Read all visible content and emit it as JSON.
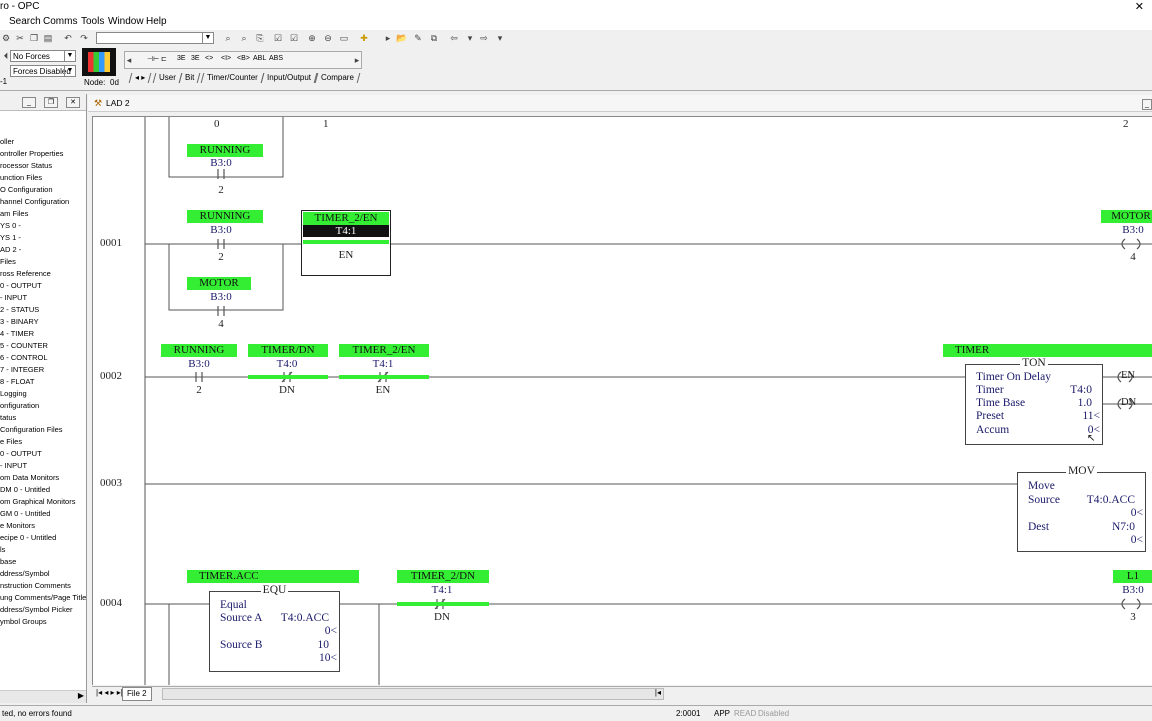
{
  "window": {
    "title": "ro - OPC",
    "close_glyph": "✕"
  },
  "menu": [
    "Search",
    "Comms",
    "Tools",
    "Window",
    "Help"
  ],
  "toolbar": {
    "forces_combo": "No Forces",
    "forces_state": "Forces Disabled",
    "node_label": "Node:",
    "node_value": "0d",
    "left_edge_label": "-1",
    "tabs": [
      "User",
      "Bit",
      "Timer/Counter",
      "Input/Output",
      "Compare"
    ],
    "instruction_glyphs": [
      "⊣⊢",
      "⊏",
      "3E",
      "3E",
      "<>",
      "<I>",
      "<B>",
      "ABL",
      "ABS"
    ]
  },
  "project_tree": [
    "oller",
    "ontroller Properties",
    "rocessor Status",
    "unction Files",
    "O Configuration",
    "hannel Configuration",
    "am Files",
    "YS 0 -",
    "YS 1 -",
    "AD 2 -",
    "Files",
    "ross Reference",
    "0 - OUTPUT",
    "- INPUT",
    "2 - STATUS",
    "3 - BINARY",
    "4 - TIMER",
    "5 - COUNTER",
    "6 - CONTROL",
    "7 - INTEGER",
    "8 - FLOAT",
    "Logging",
    "onfiguration",
    "tatus",
    "Configuration Files",
    "e Files",
    "0 - OUTPUT",
    "- INPUT",
    "om Data Monitors",
    "DM 0 - Untitled",
    "om Graphical Monitors",
    "GM 0 - Untitled",
    "e Monitors",
    "ecipe 0 - Untitled",
    "ls",
    "base",
    "ddress/Symbol",
    "nstruction Comments",
    "ung Comments/Page Title",
    "ddress/Symbol Picker",
    "ymbol Groups"
  ],
  "ladder": {
    "window_title": "LAD 2",
    "file_tab": "File 2",
    "columns": [
      "0",
      "1",
      "2"
    ],
    "rungs": [
      "0001",
      "0002",
      "0003",
      "0004"
    ],
    "rung0_tail": {
      "tag": "RUNNING",
      "addr": "B3:0",
      "bit": "2"
    },
    "rung1": {
      "xic_running": {
        "tag": "RUNNING",
        "addr": "B3:0",
        "bit": "2"
      },
      "xio_timer": {
        "tag": "TIMER_2/EN",
        "addr": "T4:1",
        "bit": "EN"
      },
      "xic_motor": {
        "tag": "MOTOR",
        "addr": "B3:0",
        "bit": "4"
      },
      "ote_motor": {
        "tag": "MOTOR",
        "addr": "B3:0",
        "bit": "4"
      }
    },
    "rung2": {
      "xic_running": {
        "tag": "RUNNING",
        "addr": "B3:0",
        "bit": "2"
      },
      "xio_timer_dn": {
        "tag": "TIMER/DN",
        "addr": "T4:0",
        "bit": "DN"
      },
      "xio_timer2_en": {
        "tag": "TIMER_2/EN",
        "addr": "T4:1",
        "bit": "EN"
      },
      "ton": {
        "tag": "TIMER",
        "title": "TON",
        "desc": "Timer On Delay",
        "timer_label": "Timer",
        "timer_value": "T4:0",
        "timebase_label": "Time Base",
        "timebase_value": "1.0",
        "preset_label": "Preset",
        "preset_value": "11<",
        "accum_label": "Accum",
        "accum_value": "0<",
        "en": "EN",
        "dn": "DN"
      }
    },
    "rung3": {
      "mov": {
        "title": "MOV",
        "desc": "Move",
        "source_label": "Source",
        "source_value": "T4:0.ACC",
        "source_live": "0<",
        "dest_label": "Dest",
        "dest_value": "N7:0",
        "dest_live": "0<"
      }
    },
    "rung4": {
      "equ": {
        "tag": "TIMER.ACC",
        "title": "EQU",
        "desc": "Equal",
        "srca_label": "Source A",
        "srca_value": "T4:0.ACC",
        "srca_live": "0<",
        "srcb_label": "Source B",
        "srcb_value": "10",
        "srcb_live": "10<"
      },
      "xio_timer2_dn": {
        "tag": "TIMER_2/DN",
        "addr": "T4:1",
        "bit": "DN"
      },
      "otl": {
        "tag": "L1",
        "addr": "B3:0",
        "bit": "3"
      }
    }
  },
  "status": {
    "message": "ted, no errors found",
    "rung_pos": "2:0001",
    "mode": "APP",
    "read": "READ",
    "disabled": "Disabled"
  },
  "colors": {
    "highlight": "#33ee33",
    "address": "#1a1a6a"
  }
}
